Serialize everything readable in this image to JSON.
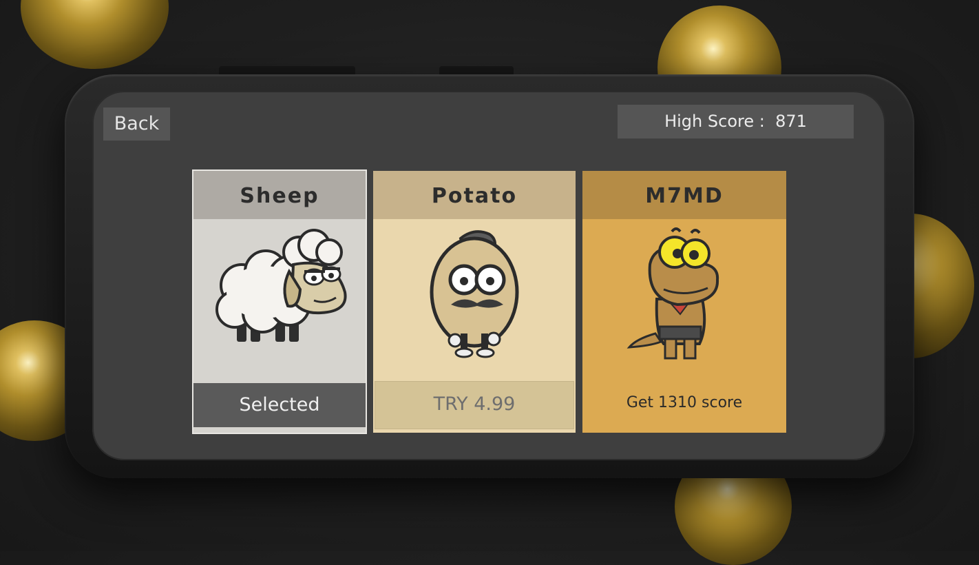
{
  "top_bar": {
    "back_label": "Back",
    "high_score_label": "High Score :",
    "high_score_value": "871"
  },
  "characters": [
    {
      "name": "Sheep",
      "status": "Selected",
      "icon": "sheep-icon"
    },
    {
      "name": "Potato",
      "status": "TRY 4.99",
      "icon": "potato-icon"
    },
    {
      "name": "M7MD",
      "status": "Get 1310 score",
      "icon": "dinosaur-icon"
    }
  ],
  "colors": {
    "sheep_card": "#d6d4cf",
    "potato_card": "#ead7ad",
    "m7md_card": "#dcaa52",
    "panel": "#555555"
  }
}
